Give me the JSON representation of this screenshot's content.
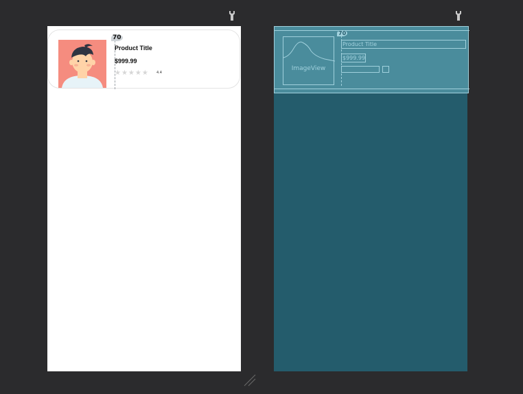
{
  "design": {
    "guide_value": "70",
    "product_title": "Product Title",
    "price": "$999.99",
    "rating_text": "4.4",
    "stars": "★★★★★"
  },
  "blueprint": {
    "guide_value": "70",
    "image_label": "ImageView",
    "product_title": "Product Title",
    "price": "$999.99"
  },
  "icons": {
    "left_toolbar": "wrench-icon",
    "right_toolbar": "wrench-icon",
    "resize": "resize-handle-icon"
  }
}
